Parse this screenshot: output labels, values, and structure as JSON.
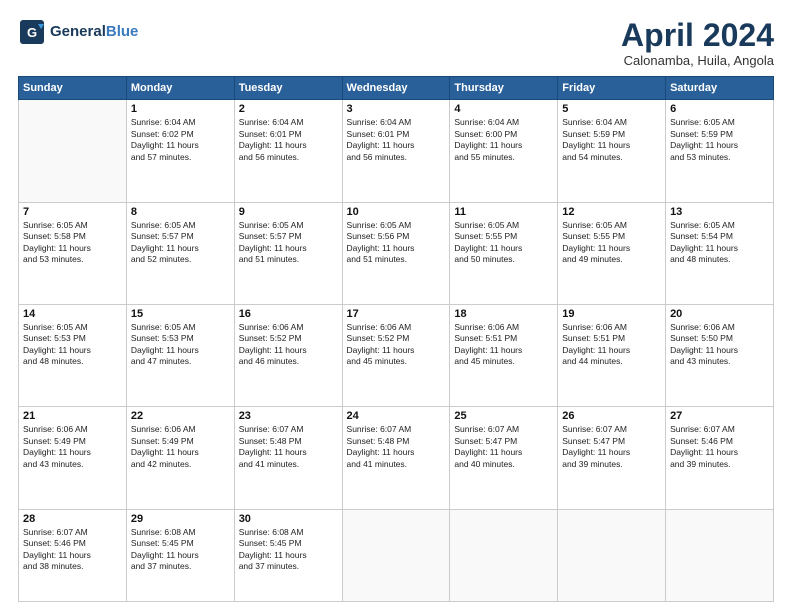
{
  "header": {
    "logo_line1": "General",
    "logo_line2": "Blue",
    "month_title": "April 2024",
    "subtitle": "Calonamba, Huila, Angola"
  },
  "weekdays": [
    "Sunday",
    "Monday",
    "Tuesday",
    "Wednesday",
    "Thursday",
    "Friday",
    "Saturday"
  ],
  "weeks": [
    [
      {
        "day": "",
        "info": ""
      },
      {
        "day": "1",
        "info": "Sunrise: 6:04 AM\nSunset: 6:02 PM\nDaylight: 11 hours\nand 57 minutes."
      },
      {
        "day": "2",
        "info": "Sunrise: 6:04 AM\nSunset: 6:01 PM\nDaylight: 11 hours\nand 56 minutes."
      },
      {
        "day": "3",
        "info": "Sunrise: 6:04 AM\nSunset: 6:01 PM\nDaylight: 11 hours\nand 56 minutes."
      },
      {
        "day": "4",
        "info": "Sunrise: 6:04 AM\nSunset: 6:00 PM\nDaylight: 11 hours\nand 55 minutes."
      },
      {
        "day": "5",
        "info": "Sunrise: 6:04 AM\nSunset: 5:59 PM\nDaylight: 11 hours\nand 54 minutes."
      },
      {
        "day": "6",
        "info": "Sunrise: 6:05 AM\nSunset: 5:59 PM\nDaylight: 11 hours\nand 53 minutes."
      }
    ],
    [
      {
        "day": "7",
        "info": "Sunrise: 6:05 AM\nSunset: 5:58 PM\nDaylight: 11 hours\nand 53 minutes."
      },
      {
        "day": "8",
        "info": "Sunrise: 6:05 AM\nSunset: 5:57 PM\nDaylight: 11 hours\nand 52 minutes."
      },
      {
        "day": "9",
        "info": "Sunrise: 6:05 AM\nSunset: 5:57 PM\nDaylight: 11 hours\nand 51 minutes."
      },
      {
        "day": "10",
        "info": "Sunrise: 6:05 AM\nSunset: 5:56 PM\nDaylight: 11 hours\nand 51 minutes."
      },
      {
        "day": "11",
        "info": "Sunrise: 6:05 AM\nSunset: 5:55 PM\nDaylight: 11 hours\nand 50 minutes."
      },
      {
        "day": "12",
        "info": "Sunrise: 6:05 AM\nSunset: 5:55 PM\nDaylight: 11 hours\nand 49 minutes."
      },
      {
        "day": "13",
        "info": "Sunrise: 6:05 AM\nSunset: 5:54 PM\nDaylight: 11 hours\nand 48 minutes."
      }
    ],
    [
      {
        "day": "14",
        "info": "Sunrise: 6:05 AM\nSunset: 5:53 PM\nDaylight: 11 hours\nand 48 minutes."
      },
      {
        "day": "15",
        "info": "Sunrise: 6:05 AM\nSunset: 5:53 PM\nDaylight: 11 hours\nand 47 minutes."
      },
      {
        "day": "16",
        "info": "Sunrise: 6:06 AM\nSunset: 5:52 PM\nDaylight: 11 hours\nand 46 minutes."
      },
      {
        "day": "17",
        "info": "Sunrise: 6:06 AM\nSunset: 5:52 PM\nDaylight: 11 hours\nand 45 minutes."
      },
      {
        "day": "18",
        "info": "Sunrise: 6:06 AM\nSunset: 5:51 PM\nDaylight: 11 hours\nand 45 minutes."
      },
      {
        "day": "19",
        "info": "Sunrise: 6:06 AM\nSunset: 5:51 PM\nDaylight: 11 hours\nand 44 minutes."
      },
      {
        "day": "20",
        "info": "Sunrise: 6:06 AM\nSunset: 5:50 PM\nDaylight: 11 hours\nand 43 minutes."
      }
    ],
    [
      {
        "day": "21",
        "info": "Sunrise: 6:06 AM\nSunset: 5:49 PM\nDaylight: 11 hours\nand 43 minutes."
      },
      {
        "day": "22",
        "info": "Sunrise: 6:06 AM\nSunset: 5:49 PM\nDaylight: 11 hours\nand 42 minutes."
      },
      {
        "day": "23",
        "info": "Sunrise: 6:07 AM\nSunset: 5:48 PM\nDaylight: 11 hours\nand 41 minutes."
      },
      {
        "day": "24",
        "info": "Sunrise: 6:07 AM\nSunset: 5:48 PM\nDaylight: 11 hours\nand 41 minutes."
      },
      {
        "day": "25",
        "info": "Sunrise: 6:07 AM\nSunset: 5:47 PM\nDaylight: 11 hours\nand 40 minutes."
      },
      {
        "day": "26",
        "info": "Sunrise: 6:07 AM\nSunset: 5:47 PM\nDaylight: 11 hours\nand 39 minutes."
      },
      {
        "day": "27",
        "info": "Sunrise: 6:07 AM\nSunset: 5:46 PM\nDaylight: 11 hours\nand 39 minutes."
      }
    ],
    [
      {
        "day": "28",
        "info": "Sunrise: 6:07 AM\nSunset: 5:46 PM\nDaylight: 11 hours\nand 38 minutes."
      },
      {
        "day": "29",
        "info": "Sunrise: 6:08 AM\nSunset: 5:45 PM\nDaylight: 11 hours\nand 37 minutes."
      },
      {
        "day": "30",
        "info": "Sunrise: 6:08 AM\nSunset: 5:45 PM\nDaylight: 11 hours\nand 37 minutes."
      },
      {
        "day": "",
        "info": ""
      },
      {
        "day": "",
        "info": ""
      },
      {
        "day": "",
        "info": ""
      },
      {
        "day": "",
        "info": ""
      }
    ]
  ]
}
